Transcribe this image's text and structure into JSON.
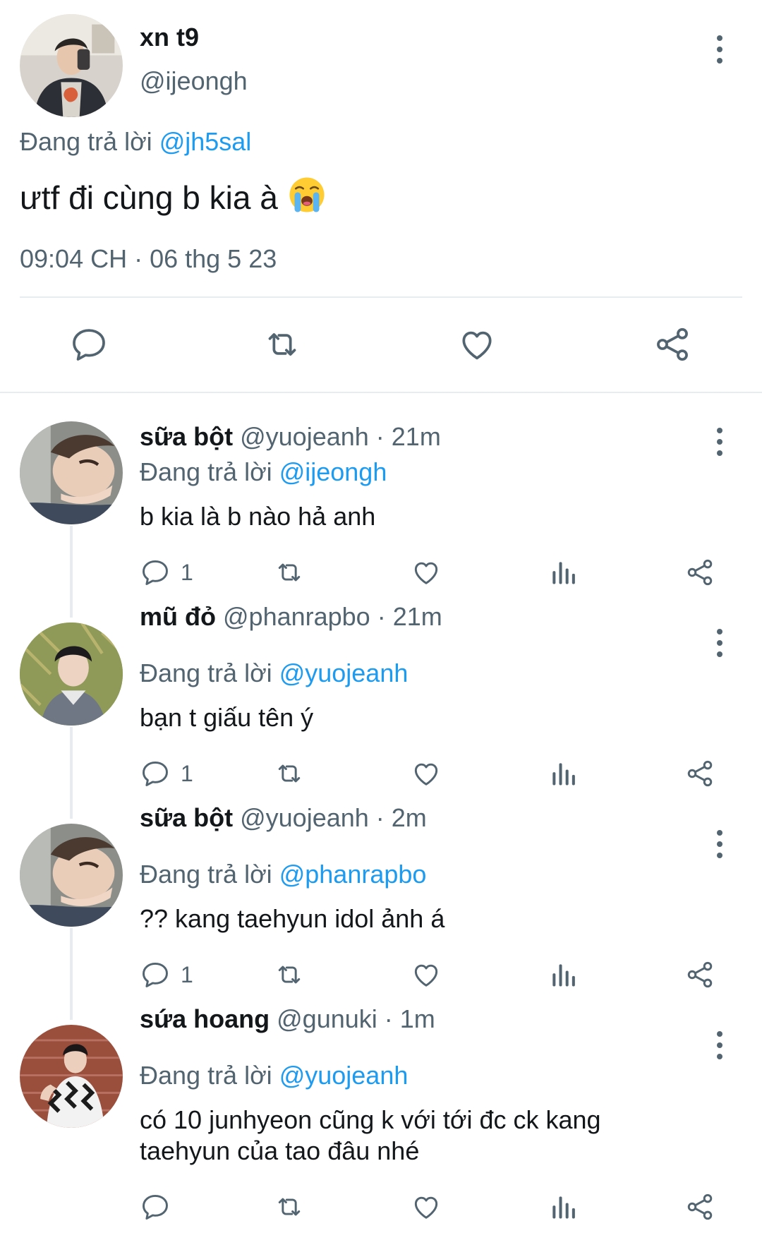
{
  "main_tweet": {
    "display_name": "xn t9",
    "handle": "@ijeongh",
    "reply_prefix": "Đang trả lời",
    "reply_to": "@jh5sal",
    "text": "ưtf đi cùng b kia à",
    "emoji": "loudly-crying-face",
    "timestamp": "09:04 CH · 06 thg 5 23",
    "actions": [
      "reply",
      "retweet",
      "like",
      "share"
    ]
  },
  "replies": [
    {
      "display_name": "sữa bột",
      "handle": "@yuojeanh",
      "time": "· 21m",
      "reply_prefix": "Đang trả lời",
      "reply_to": "@ijeongh",
      "text": "b kia là b nào hả anh",
      "reply_count": "1"
    },
    {
      "display_name": "mũ đỏ",
      "handle": "@phanrapbo",
      "time": "· 21m",
      "reply_prefix": "Đang trả lời",
      "reply_to": "@yuojeanh",
      "text": "bạn t giấu tên ý",
      "reply_count": "1"
    },
    {
      "display_name": "sữa bột",
      "handle": "@yuojeanh",
      "time": "· 2m",
      "reply_prefix": "Đang trả lời",
      "reply_to": "@phanrapbo",
      "text": "?? kang taehyun idol ảnh á",
      "reply_count": "1"
    },
    {
      "display_name": "sứa hoang",
      "handle": "@gunuki",
      "time": "· 1m",
      "reply_prefix": "Đang trả lời",
      "reply_to": "@yuojeanh",
      "text_line1": "có 10 junhyeon cũng k với tới đc ck kang",
      "text_line2": "taehyun của tao đâu nhé",
      "reply_count": ""
    }
  ],
  "colors": {
    "accent": "#1d9bf0",
    "secondary_text": "#536471",
    "divider": "#e6ecf0"
  }
}
